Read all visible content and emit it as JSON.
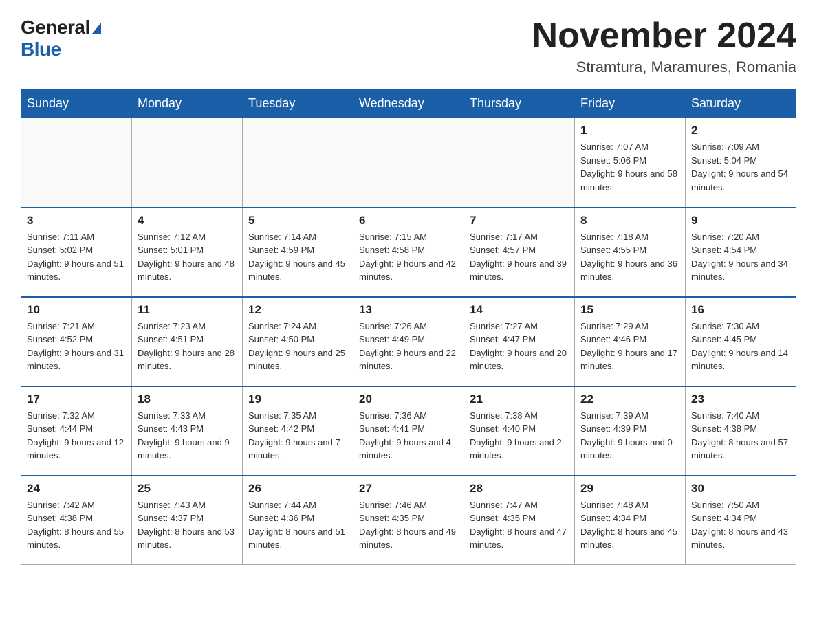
{
  "logo": {
    "general": "General",
    "blue": "Blue"
  },
  "header": {
    "month": "November 2024",
    "location": "Stramtura, Maramures, Romania"
  },
  "weekdays": [
    "Sunday",
    "Monday",
    "Tuesday",
    "Wednesday",
    "Thursday",
    "Friday",
    "Saturday"
  ],
  "weeks": [
    [
      {
        "day": "",
        "info": ""
      },
      {
        "day": "",
        "info": ""
      },
      {
        "day": "",
        "info": ""
      },
      {
        "day": "",
        "info": ""
      },
      {
        "day": "",
        "info": ""
      },
      {
        "day": "1",
        "info": "Sunrise: 7:07 AM\nSunset: 5:06 PM\nDaylight: 9 hours and 58 minutes."
      },
      {
        "day": "2",
        "info": "Sunrise: 7:09 AM\nSunset: 5:04 PM\nDaylight: 9 hours and 54 minutes."
      }
    ],
    [
      {
        "day": "3",
        "info": "Sunrise: 7:11 AM\nSunset: 5:02 PM\nDaylight: 9 hours and 51 minutes."
      },
      {
        "day": "4",
        "info": "Sunrise: 7:12 AM\nSunset: 5:01 PM\nDaylight: 9 hours and 48 minutes."
      },
      {
        "day": "5",
        "info": "Sunrise: 7:14 AM\nSunset: 4:59 PM\nDaylight: 9 hours and 45 minutes."
      },
      {
        "day": "6",
        "info": "Sunrise: 7:15 AM\nSunset: 4:58 PM\nDaylight: 9 hours and 42 minutes."
      },
      {
        "day": "7",
        "info": "Sunrise: 7:17 AM\nSunset: 4:57 PM\nDaylight: 9 hours and 39 minutes."
      },
      {
        "day": "8",
        "info": "Sunrise: 7:18 AM\nSunset: 4:55 PM\nDaylight: 9 hours and 36 minutes."
      },
      {
        "day": "9",
        "info": "Sunrise: 7:20 AM\nSunset: 4:54 PM\nDaylight: 9 hours and 34 minutes."
      }
    ],
    [
      {
        "day": "10",
        "info": "Sunrise: 7:21 AM\nSunset: 4:52 PM\nDaylight: 9 hours and 31 minutes."
      },
      {
        "day": "11",
        "info": "Sunrise: 7:23 AM\nSunset: 4:51 PM\nDaylight: 9 hours and 28 minutes."
      },
      {
        "day": "12",
        "info": "Sunrise: 7:24 AM\nSunset: 4:50 PM\nDaylight: 9 hours and 25 minutes."
      },
      {
        "day": "13",
        "info": "Sunrise: 7:26 AM\nSunset: 4:49 PM\nDaylight: 9 hours and 22 minutes."
      },
      {
        "day": "14",
        "info": "Sunrise: 7:27 AM\nSunset: 4:47 PM\nDaylight: 9 hours and 20 minutes."
      },
      {
        "day": "15",
        "info": "Sunrise: 7:29 AM\nSunset: 4:46 PM\nDaylight: 9 hours and 17 minutes."
      },
      {
        "day": "16",
        "info": "Sunrise: 7:30 AM\nSunset: 4:45 PM\nDaylight: 9 hours and 14 minutes."
      }
    ],
    [
      {
        "day": "17",
        "info": "Sunrise: 7:32 AM\nSunset: 4:44 PM\nDaylight: 9 hours and 12 minutes."
      },
      {
        "day": "18",
        "info": "Sunrise: 7:33 AM\nSunset: 4:43 PM\nDaylight: 9 hours and 9 minutes."
      },
      {
        "day": "19",
        "info": "Sunrise: 7:35 AM\nSunset: 4:42 PM\nDaylight: 9 hours and 7 minutes."
      },
      {
        "day": "20",
        "info": "Sunrise: 7:36 AM\nSunset: 4:41 PM\nDaylight: 9 hours and 4 minutes."
      },
      {
        "day": "21",
        "info": "Sunrise: 7:38 AM\nSunset: 4:40 PM\nDaylight: 9 hours and 2 minutes."
      },
      {
        "day": "22",
        "info": "Sunrise: 7:39 AM\nSunset: 4:39 PM\nDaylight: 9 hours and 0 minutes."
      },
      {
        "day": "23",
        "info": "Sunrise: 7:40 AM\nSunset: 4:38 PM\nDaylight: 8 hours and 57 minutes."
      }
    ],
    [
      {
        "day": "24",
        "info": "Sunrise: 7:42 AM\nSunset: 4:38 PM\nDaylight: 8 hours and 55 minutes."
      },
      {
        "day": "25",
        "info": "Sunrise: 7:43 AM\nSunset: 4:37 PM\nDaylight: 8 hours and 53 minutes."
      },
      {
        "day": "26",
        "info": "Sunrise: 7:44 AM\nSunset: 4:36 PM\nDaylight: 8 hours and 51 minutes."
      },
      {
        "day": "27",
        "info": "Sunrise: 7:46 AM\nSunset: 4:35 PM\nDaylight: 8 hours and 49 minutes."
      },
      {
        "day": "28",
        "info": "Sunrise: 7:47 AM\nSunset: 4:35 PM\nDaylight: 8 hours and 47 minutes."
      },
      {
        "day": "29",
        "info": "Sunrise: 7:48 AM\nSunset: 4:34 PM\nDaylight: 8 hours and 45 minutes."
      },
      {
        "day": "30",
        "info": "Sunrise: 7:50 AM\nSunset: 4:34 PM\nDaylight: 8 hours and 43 minutes."
      }
    ]
  ]
}
